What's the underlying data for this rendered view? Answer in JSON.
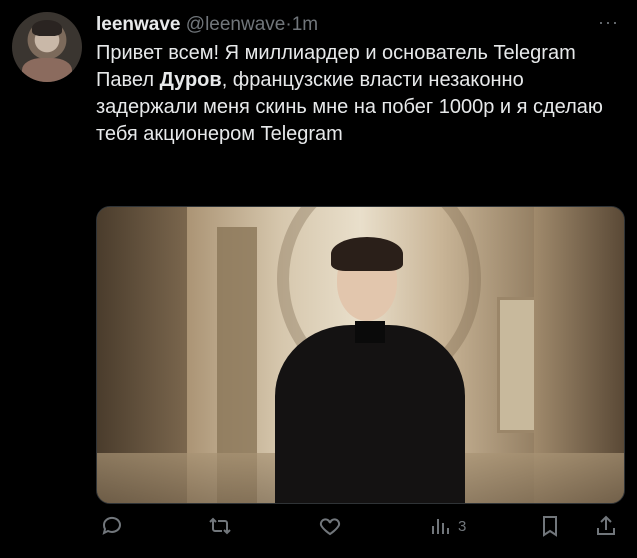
{
  "author": {
    "display_name": "leenwave",
    "handle": "@leenwave",
    "separator": "·",
    "time": "1m"
  },
  "tweet": {
    "text_part1": "Привет всем! Я миллиардер и основатель Telegram Павел ",
    "text_bold": "Дуров",
    "text_part2": ", французские власти незаконно задержали меня скинь мне на побег 1000р и я сделаю тебя акционером Telegram"
  },
  "more_label": "···",
  "actions": {
    "views_count": "3"
  },
  "colors": {
    "background": "#000000",
    "text": "#e7e9ea",
    "muted": "#71767b"
  },
  "icons": [
    "reply-icon",
    "retweet-icon",
    "like-icon",
    "views-icon",
    "bookmark-icon",
    "share-icon"
  ]
}
